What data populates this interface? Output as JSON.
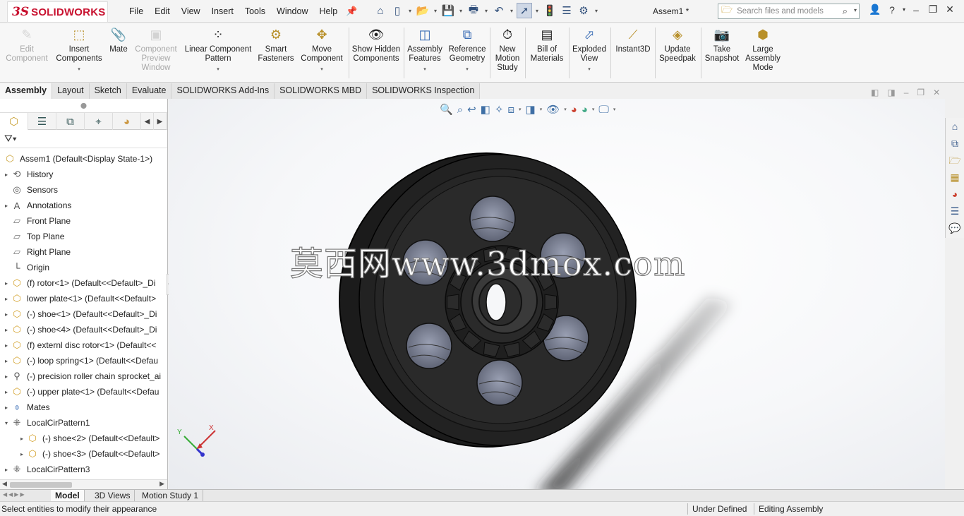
{
  "titlebar": {
    "logo": {
      "ds": "3S",
      "brand": "SOLIDWORKS"
    },
    "menus": [
      "File",
      "Edit",
      "View",
      "Insert",
      "Tools",
      "Window",
      "Help"
    ],
    "doc_title": "Assem1 *",
    "search_placeholder": "Search files and models",
    "quick_access_icons": [
      "home-icon",
      "new-icon",
      "open-icon",
      "save-icon",
      "print-icon",
      "undo-icon",
      "select-icon",
      "rebuild-icon",
      "file-properties-icon",
      "options-icon"
    ]
  },
  "ribbon": {
    "commands": [
      {
        "label": "Edit Component",
        "icon": "edit-component-icon",
        "disabled": true
      },
      {
        "label": "Insert Components",
        "icon": "insert-components-icon",
        "disabled": false,
        "dropdown": true
      },
      {
        "label": "Mate",
        "icon": "mate-icon",
        "disabled": false
      },
      {
        "label": "Component Preview Window",
        "icon": "component-preview-icon",
        "disabled": true
      },
      {
        "label": "Linear Component Pattern",
        "icon": "linear-pattern-icon",
        "disabled": false,
        "dropdown": true
      },
      {
        "label": "Smart Fasteners",
        "icon": "smart-fasteners-icon",
        "disabled": false
      },
      {
        "label": "Move Component",
        "icon": "move-component-icon",
        "disabled": false,
        "dropdown": true
      },
      {
        "label": "Show Hidden Components",
        "icon": "show-hidden-icon",
        "disabled": false
      },
      {
        "label": "Assembly Features",
        "icon": "assembly-features-icon",
        "disabled": false,
        "dropdown": true
      },
      {
        "label": "Reference Geometry",
        "icon": "reference-geometry-icon",
        "disabled": false,
        "dropdown": true
      },
      {
        "label": "New Motion Study",
        "icon": "motion-study-icon",
        "disabled": false
      },
      {
        "label": "Bill of Materials",
        "icon": "bom-icon",
        "disabled": false
      },
      {
        "label": "Exploded View",
        "icon": "exploded-view-icon",
        "disabled": false,
        "dropdown": true
      },
      {
        "label": "Instant3D",
        "icon": "instant3d-icon",
        "disabled": false
      },
      {
        "label": "Update Speedpak",
        "icon": "speedpak-icon",
        "disabled": false
      },
      {
        "label": "Take Snapshot",
        "icon": "snapshot-icon",
        "disabled": false
      },
      {
        "label": "Large Assembly Mode",
        "icon": "large-assembly-icon",
        "disabled": false
      }
    ]
  },
  "tabs": [
    "Assembly",
    "Layout",
    "Sketch",
    "Evaluate",
    "SOLIDWORKS Add-Ins",
    "SOLIDWORKS MBD",
    "SOLIDWORKS Inspection"
  ],
  "active_tab": "Assembly",
  "feature_tree": {
    "root": "Assem1  (Default<Display State-1>)",
    "items": [
      {
        "label": "History",
        "icon": "history-icon",
        "expandable": true,
        "indent": 0
      },
      {
        "label": "Sensors",
        "icon": "sensors-icon",
        "expandable": false,
        "indent": 0
      },
      {
        "label": "Annotations",
        "icon": "annotations-icon",
        "expandable": true,
        "indent": 0
      },
      {
        "label": "Front Plane",
        "icon": "plane-icon",
        "expandable": false,
        "indent": 0
      },
      {
        "label": "Top Plane",
        "icon": "plane-icon",
        "expandable": false,
        "indent": 0
      },
      {
        "label": "Right Plane",
        "icon": "plane-icon",
        "expandable": false,
        "indent": 0
      },
      {
        "label": "Origin",
        "icon": "origin-icon",
        "expandable": false,
        "indent": 0
      },
      {
        "label": "(f) rotor<1> (Default<<Default>_Di",
        "icon": "part-icon",
        "expandable": true,
        "indent": 0
      },
      {
        "label": "lower plate<1> (Default<<Default>",
        "icon": "part-icon",
        "expandable": true,
        "indent": 0
      },
      {
        "label": "(-) shoe<1> (Default<<Default>_Di",
        "icon": "part-icon",
        "expandable": true,
        "indent": 0
      },
      {
        "label": "(-) shoe<4> (Default<<Default>_Di",
        "icon": "part-icon",
        "expandable": true,
        "indent": 0
      },
      {
        "label": "(f) externl disc rotor<1> (Default<<",
        "icon": "part-icon",
        "expandable": true,
        "indent": 0
      },
      {
        "label": "(-) loop spring<1> (Default<<Defau",
        "icon": "part-icon",
        "expandable": true,
        "indent": 0
      },
      {
        "label": "(-) precision roller chain sprocket_ai",
        "icon": "toolbox-part-icon",
        "expandable": true,
        "indent": 0
      },
      {
        "label": "(-) upper plate<1> (Default<<Defau",
        "icon": "part-icon",
        "expandable": true,
        "indent": 0
      },
      {
        "label": "Mates",
        "icon": "mates-icon",
        "expandable": true,
        "indent": 0
      },
      {
        "label": "LocalCirPattern1",
        "icon": "circular-pattern-icon",
        "expandable": true,
        "expanded": true,
        "indent": 0
      },
      {
        "label": "(-) shoe<2> (Default<<Default>",
        "icon": "part-icon",
        "expandable": true,
        "indent": 1
      },
      {
        "label": "(-) shoe<3> (Default<<Default>",
        "icon": "part-icon",
        "expandable": true,
        "indent": 1
      },
      {
        "label": "LocalCirPattern3",
        "icon": "circular-pattern-icon",
        "expandable": true,
        "indent": 0
      }
    ]
  },
  "viewport": {
    "watermark": "莫西网www.3dmox.com",
    "triad": {
      "x": "X",
      "y": "Y"
    }
  },
  "bottom_tabs": [
    "Model",
    "3D Views",
    "Motion Study 1"
  ],
  "active_bottom_tab": "Model",
  "status": {
    "message": "Select entities to modify their appearance",
    "define_state": "Under Defined",
    "mode": "Editing Assembly"
  },
  "colors": {
    "brand_red": "#c8102e",
    "part_yellow": "#d3a12b",
    "ribbon_bg": "#f7f7f7"
  }
}
